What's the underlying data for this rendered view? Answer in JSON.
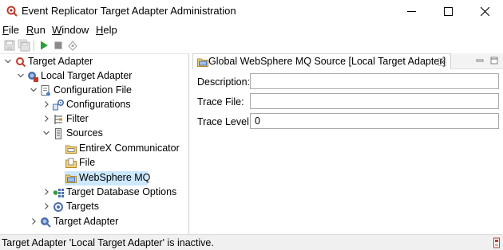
{
  "window": {
    "title": "Event Replicator Target Adapter Administration",
    "controls": {
      "minimize_icon": "minimize-icon",
      "maximize_icon": "maximize-icon",
      "close_icon": "close-icon"
    }
  },
  "menu": {
    "file": {
      "mnemonic": "F",
      "rest": "ile"
    },
    "run": {
      "mnemonic": "R",
      "rest": "un"
    },
    "window": {
      "mnemonic": "W",
      "rest": "indow"
    },
    "help": {
      "mnemonic": "H",
      "rest": "elp"
    }
  },
  "tree": {
    "root": "Target Adapter",
    "local_adapter": "Local Target Adapter",
    "configuration_file": "Configuration File",
    "configurations": "Configurations",
    "filter": "Filter",
    "sources": "Sources",
    "entirex": "EntireX Communicator",
    "file": "File",
    "websphere": "WebSphere MQ",
    "db_options": "Target Database Options",
    "targets": "Targets",
    "target_adapter_2": "Target Adapter"
  },
  "editor": {
    "tab_title": "Global WebSphere MQ Source [Local Target Adapter]",
    "fields": {
      "description_label": "Description:",
      "description_value": "",
      "trace_file_label": "Trace File:",
      "trace_file_value": "",
      "trace_level_label": "Trace Level:",
      "trace_level_value": "0"
    }
  },
  "status": {
    "message": "Target Adapter 'Local Target Adapter' is inactive."
  },
  "colors": {
    "selection": "#cce8ff",
    "accent_red": "#c0392b",
    "run_green": "#2e9d3a"
  }
}
